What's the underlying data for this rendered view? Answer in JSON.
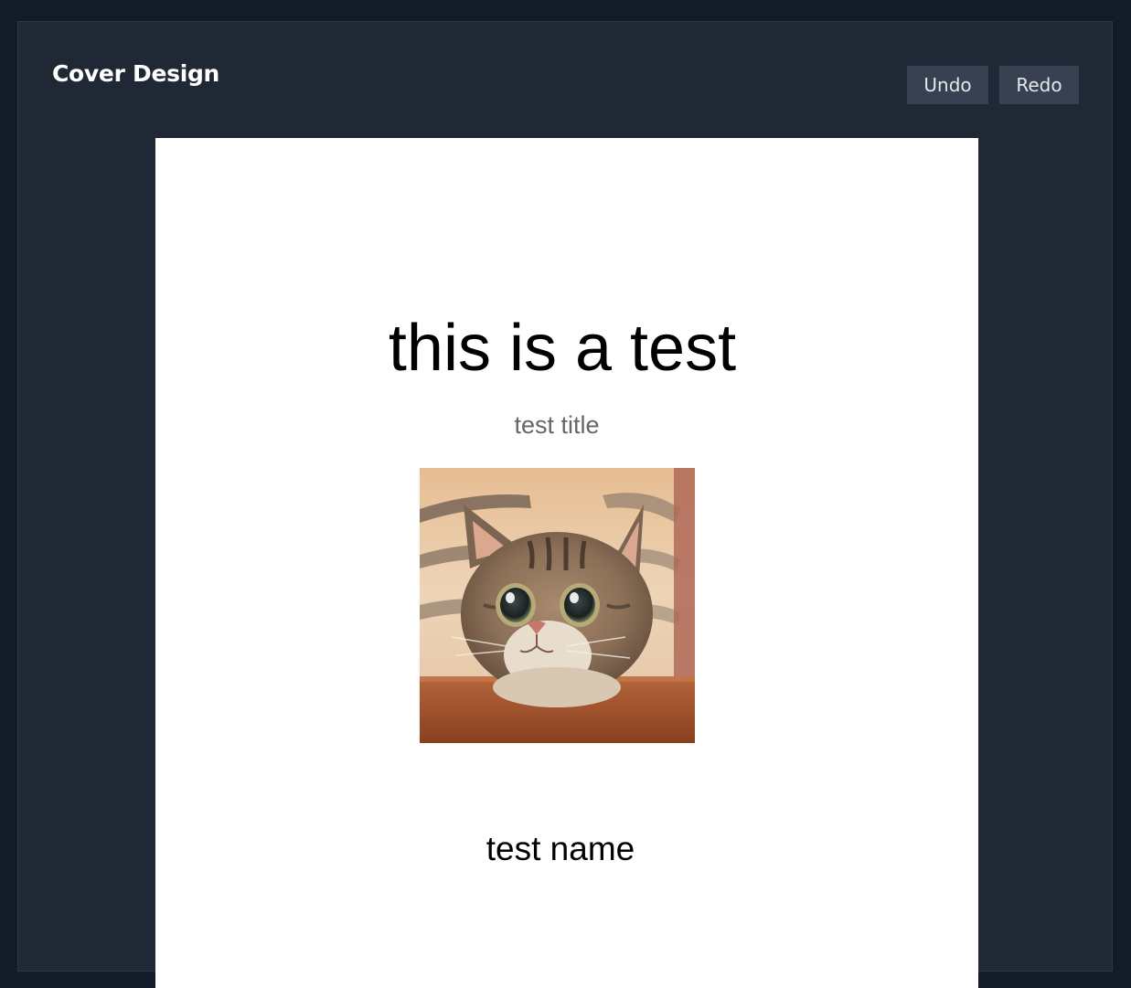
{
  "app": {
    "title": "Cover Design"
  },
  "toolbar": {
    "undo_label": "Undo",
    "redo_label": "Redo"
  },
  "cover": {
    "heading": "this is a test",
    "subtitle": "test title",
    "image": "cat-photo",
    "name": "test name"
  },
  "colors": {
    "page_background": "#131a28",
    "panel_background": "#202836",
    "button_background": "#374151",
    "canvas_background": "#ffffff",
    "subtitle_text": "#666666"
  }
}
